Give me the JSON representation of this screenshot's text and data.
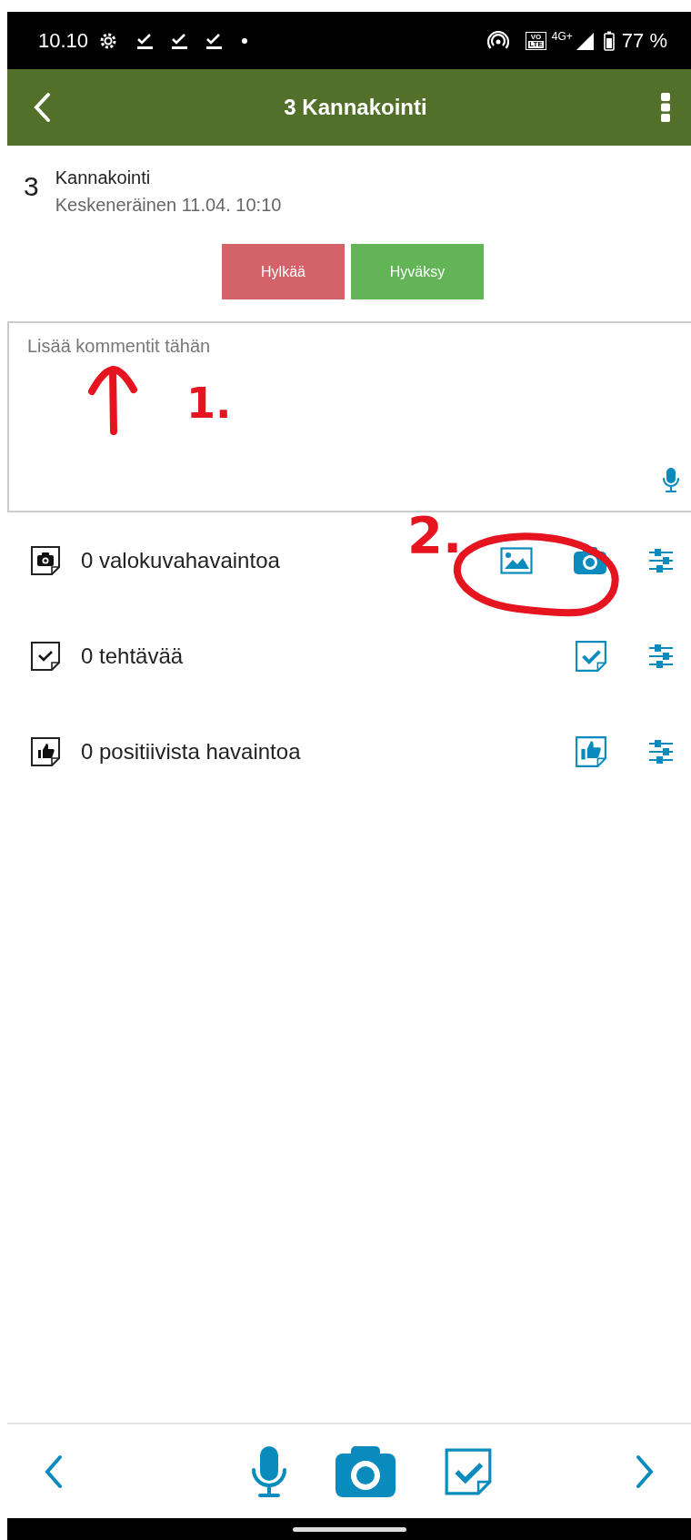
{
  "status_bar": {
    "time": "10.10",
    "volte": [
      "VO",
      "LTE"
    ],
    "network": "4G+",
    "battery": "77 %"
  },
  "header": {
    "title": "3 Kannakointi"
  },
  "item": {
    "number": "3",
    "title": "Kannakointi",
    "status": "Keskeneräinen 11.04. 10:10"
  },
  "buttons": [
    {
      "label": "Hylkää",
      "kind": "reject"
    },
    {
      "label": "Hyväksy",
      "kind": "accept"
    }
  ],
  "comment": {
    "placeholder": "Lisää kommentit tähän"
  },
  "rows": [
    {
      "kind": "photo",
      "label": "0 valokuvahavaintoa"
    },
    {
      "kind": "task",
      "label": "0 tehtävää"
    },
    {
      "kind": "positive",
      "label": "0 positiivista havaintoa"
    }
  ],
  "annotations": [
    {
      "label": "1."
    },
    {
      "label": "2."
    }
  ]
}
